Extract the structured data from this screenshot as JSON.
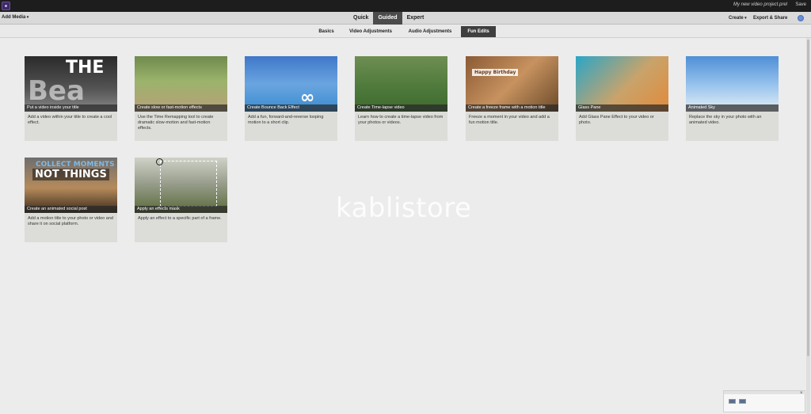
{
  "top": {
    "project_name": "My new video project.prel",
    "save": "Save"
  },
  "modebar": {
    "add_media": "Add Media",
    "modes": [
      "Quick",
      "Guided",
      "Expert"
    ],
    "create": "Create",
    "export": "Export & Share"
  },
  "subtabs": [
    "Basics",
    "Video Adjustments",
    "Audio Adjustments",
    "Fun Edits"
  ],
  "tiles": [
    {
      "caption": "Put a video inside your title",
      "desc": "Add a video within your title to create a cool effect.",
      "thumb_text": "THE",
      "thumb_text2": "Bea"
    },
    {
      "caption": "Create slow or fast-motion effects",
      "desc": "Use the Time Remapping tool to create dramatic slow-motion and fast-motion effects."
    },
    {
      "caption": "Create Bounce Back Effect",
      "desc": "Add a fun, forward-and-reverse looping motion to a short clip.",
      "icon": "∞"
    },
    {
      "caption": "Create Time-lapse video",
      "desc": "Learn how to create a time-lapse video from your photos or videos."
    },
    {
      "caption": "Create a freeze frame with a motion title",
      "desc": "Freeze a moment in your video and add a fun motion title.",
      "thumb_text": "Happy Birthday"
    },
    {
      "caption": "Glass Pane",
      "desc": "Add Glass Pane Effect to your video or photo."
    },
    {
      "caption": "Animated Sky",
      "desc": "Replace the sky in your photo with an animated video."
    },
    {
      "caption": "Create an animated social post",
      "desc": "Add a motion title to your photo or video and share it on social platform.",
      "thumb_text": "COLLECT MOMENTS",
      "thumb_text2": "NOT THINGS"
    },
    {
      "caption": "Apply an effects mask",
      "desc": "Apply an effect to a specific part of a frame."
    }
  ],
  "watermark": "kablistore",
  "mini_panel": {
    "close": "×"
  }
}
